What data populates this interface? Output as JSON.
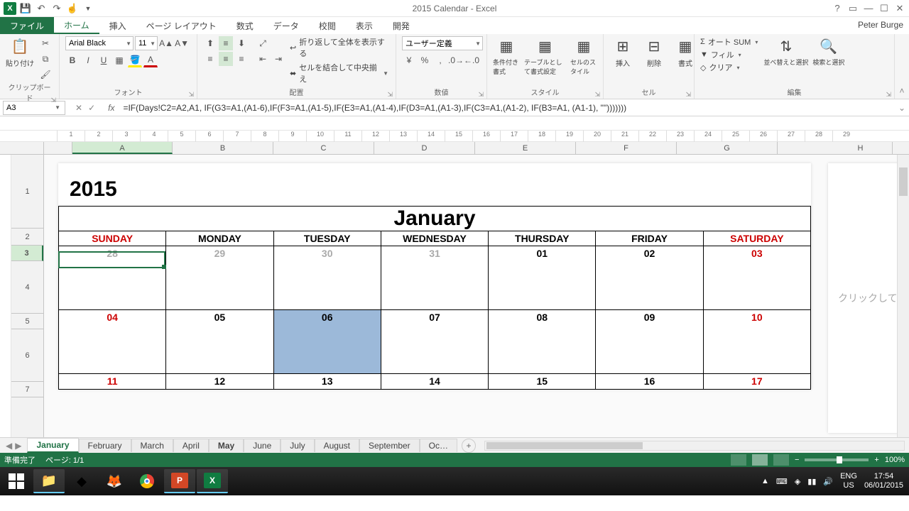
{
  "titlebar": {
    "doc_title": "2015 Calendar - Excel"
  },
  "user": "Peter Burge",
  "tabs": {
    "file": "ファイル",
    "home": "ホーム",
    "insert": "挿入",
    "layout": "ページ レイアウト",
    "formulas": "数式",
    "data": "データ",
    "review": "校閲",
    "view": "表示",
    "dev": "開発"
  },
  "ribbon": {
    "clipboard": {
      "label": "クリップボード",
      "paste": "貼り付け"
    },
    "font": {
      "label": "フォント",
      "name": "Arial Black",
      "size": "11"
    },
    "align": {
      "label": "配置",
      "wrap": "折り返して全体を表示する",
      "merge": "セルを結合して中央揃え"
    },
    "number": {
      "label": "数値",
      "format": "ユーザー定義"
    },
    "styles": {
      "label": "スタイル",
      "cond": "条件付き書式",
      "table": "テーブルとして書式設定",
      "cell": "セルのスタイル"
    },
    "cells": {
      "label": "セル",
      "insert": "挿入",
      "delete": "削除",
      "format": "書式"
    },
    "editing": {
      "label": "編集",
      "sum": "オート SUM",
      "fill": "フィル",
      "clear": "クリア",
      "sort": "並べ替えと選択",
      "find": "検索と選択"
    }
  },
  "name_box": "A3",
  "formula": "=IF(Days!C2=A2,A1, IF(G3=A1,(A1-6),IF(F3=A1,(A1-5),IF(E3=A1,(A1-4),IF(D3=A1,(A1-3),IF(C3=A1,(A1-2), IF(B3=A1, (A1-1), \"\")))))))",
  "cols": [
    "A",
    "B",
    "C",
    "D",
    "E",
    "F",
    "G",
    "H"
  ],
  "rows": [
    "1",
    "2",
    "3",
    "4",
    "5",
    "6",
    "7"
  ],
  "calendar": {
    "year": "2015",
    "month": "January",
    "days": [
      "SUNDAY",
      "MONDAY",
      "TUESDAY",
      "WEDNESDAY",
      "THURSDAY",
      "FRIDAY",
      "SATURDAY"
    ],
    "w1": [
      "28",
      "29",
      "30",
      "31",
      "01",
      "02",
      "03"
    ],
    "w2": [
      "04",
      "05",
      "06",
      "07",
      "08",
      "09",
      "10"
    ],
    "w3": [
      "11",
      "12",
      "13",
      "14",
      "15",
      "16",
      "17"
    ]
  },
  "page2_hint": "クリックして",
  "sheets": [
    "January",
    "February",
    "March",
    "April",
    "May",
    "June",
    "July",
    "August",
    "September",
    "Oc…"
  ],
  "status": {
    "ready": "準備完了",
    "page": "ページ: 1/1",
    "zoom": "100%"
  },
  "tray": {
    "lang1": "ENG",
    "lang2": "US",
    "time": "17:54",
    "date": "06/01/2015"
  }
}
